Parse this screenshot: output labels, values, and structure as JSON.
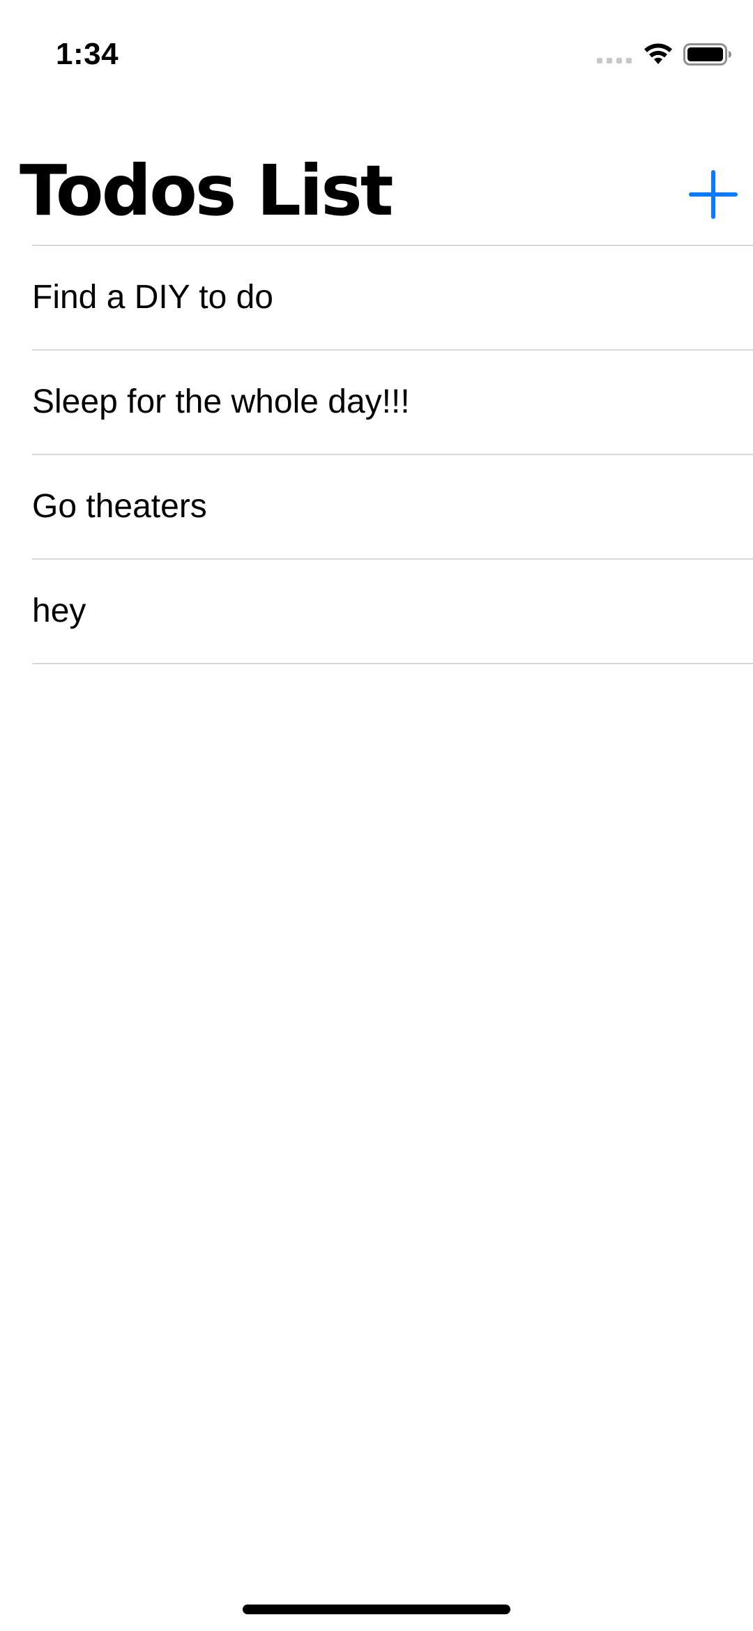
{
  "status_bar": {
    "time": "1:34"
  },
  "header": {
    "title": "Todos List",
    "add_icon": "plus-icon"
  },
  "todos": [
    {
      "label": "Find a DIY to do"
    },
    {
      "label": "Sleep for the whole day!!!"
    },
    {
      "label": "Go theaters"
    },
    {
      "label": "hey"
    }
  ],
  "colors": {
    "accent": "#0a7aff",
    "separator": "#d8d8dc",
    "text": "#000000",
    "background": "#ffffff"
  }
}
